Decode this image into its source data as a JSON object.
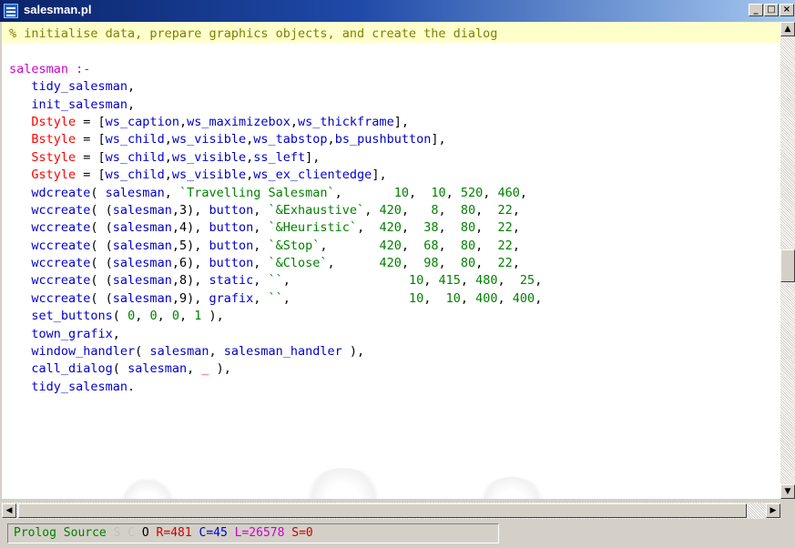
{
  "window": {
    "title": "salesman.pl",
    "controls": {
      "minimize": "_",
      "maximize": "□",
      "close": "×"
    }
  },
  "colors": {
    "comment": "#808000",
    "atom": "#0000cc",
    "head": "#cc00cc",
    "variable": "#ff0000",
    "string": "#008000",
    "number": "#008000",
    "punct": "#000000",
    "text": "#000080"
  },
  "code_lines": [
    [
      {
        "t": "% initialise data, prepare graphics objects, and create the dialog",
        "c": "comment"
      }
    ],
    [
      {
        "t": "",
        "c": "punct"
      }
    ],
    [
      {
        "t": "salesman :-",
        "c": "head"
      }
    ],
    [
      {
        "t": "   tidy_salesman",
        "c": "atom"
      },
      {
        "t": ",",
        "c": "punct"
      }
    ],
    [
      {
        "t": "   init_salesman",
        "c": "atom"
      },
      {
        "t": ",",
        "c": "punct"
      }
    ],
    [
      {
        "t": "   Dstyle",
        "c": "variable"
      },
      {
        "t": " = [",
        "c": "punct"
      },
      {
        "t": "ws_caption",
        "c": "atom"
      },
      {
        "t": ",",
        "c": "punct"
      },
      {
        "t": "ws_maximizebox",
        "c": "atom"
      },
      {
        "t": ",",
        "c": "punct"
      },
      {
        "t": "ws_thickframe",
        "c": "atom"
      },
      {
        "t": "],",
        "c": "punct"
      }
    ],
    [
      {
        "t": "   Bstyle",
        "c": "variable"
      },
      {
        "t": " = [",
        "c": "punct"
      },
      {
        "t": "ws_child",
        "c": "atom"
      },
      {
        "t": ",",
        "c": "punct"
      },
      {
        "t": "ws_visible",
        "c": "atom"
      },
      {
        "t": ",",
        "c": "punct"
      },
      {
        "t": "ws_tabstop",
        "c": "atom"
      },
      {
        "t": ",",
        "c": "punct"
      },
      {
        "t": "bs_pushbutton",
        "c": "atom"
      },
      {
        "t": "],",
        "c": "punct"
      }
    ],
    [
      {
        "t": "   Sstyle",
        "c": "variable"
      },
      {
        "t": " = [",
        "c": "punct"
      },
      {
        "t": "ws_child",
        "c": "atom"
      },
      {
        "t": ",",
        "c": "punct"
      },
      {
        "t": "ws_visible",
        "c": "atom"
      },
      {
        "t": ",",
        "c": "punct"
      },
      {
        "t": "ss_left",
        "c": "atom"
      },
      {
        "t": "],",
        "c": "punct"
      }
    ],
    [
      {
        "t": "   Gstyle",
        "c": "variable"
      },
      {
        "t": " = [",
        "c": "punct"
      },
      {
        "t": "ws_child",
        "c": "atom"
      },
      {
        "t": ",",
        "c": "punct"
      },
      {
        "t": "ws_visible",
        "c": "atom"
      },
      {
        "t": ",",
        "c": "punct"
      },
      {
        "t": "ws_ex_clientedge",
        "c": "atom"
      },
      {
        "t": "],",
        "c": "punct"
      }
    ],
    [
      {
        "t": "   wdcreate",
        "c": "atom"
      },
      {
        "t": "( ",
        "c": "punct"
      },
      {
        "t": "salesman",
        "c": "atom"
      },
      {
        "t": ", ",
        "c": "punct"
      },
      {
        "t": "`Travelling Salesman`",
        "c": "string"
      },
      {
        "t": ",       ",
        "c": "punct"
      },
      {
        "t": "10",
        "c": "number"
      },
      {
        "t": ",  ",
        "c": "punct"
      },
      {
        "t": "10",
        "c": "number"
      },
      {
        "t": ", ",
        "c": "punct"
      },
      {
        "t": "520",
        "c": "number"
      },
      {
        "t": ", ",
        "c": "punct"
      },
      {
        "t": "460",
        "c": "number"
      },
      {
        "t": ",",
        "c": "punct"
      }
    ],
    [
      {
        "t": "   wccreate",
        "c": "atom"
      },
      {
        "t": "( (",
        "c": "punct"
      },
      {
        "t": "salesman",
        "c": "atom"
      },
      {
        "t": ",3), ",
        "c": "punct"
      },
      {
        "t": "button",
        "c": "atom"
      },
      {
        "t": ", ",
        "c": "punct"
      },
      {
        "t": "`&Exhaustive`",
        "c": "string"
      },
      {
        "t": ", ",
        "c": "punct"
      },
      {
        "t": "420",
        "c": "number"
      },
      {
        "t": ",   ",
        "c": "punct"
      },
      {
        "t": "8",
        "c": "number"
      },
      {
        "t": ",  ",
        "c": "punct"
      },
      {
        "t": "80",
        "c": "number"
      },
      {
        "t": ",  ",
        "c": "punct"
      },
      {
        "t": "22",
        "c": "number"
      },
      {
        "t": ",",
        "c": "punct"
      }
    ],
    [
      {
        "t": "   wccreate",
        "c": "atom"
      },
      {
        "t": "( (",
        "c": "punct"
      },
      {
        "t": "salesman",
        "c": "atom"
      },
      {
        "t": ",4), ",
        "c": "punct"
      },
      {
        "t": "button",
        "c": "atom"
      },
      {
        "t": ", ",
        "c": "punct"
      },
      {
        "t": "`&Heuristic`",
        "c": "string"
      },
      {
        "t": ",  ",
        "c": "punct"
      },
      {
        "t": "420",
        "c": "number"
      },
      {
        "t": ",  ",
        "c": "punct"
      },
      {
        "t": "38",
        "c": "number"
      },
      {
        "t": ",  ",
        "c": "punct"
      },
      {
        "t": "80",
        "c": "number"
      },
      {
        "t": ",  ",
        "c": "punct"
      },
      {
        "t": "22",
        "c": "number"
      },
      {
        "t": ",",
        "c": "punct"
      }
    ],
    [
      {
        "t": "   wccreate",
        "c": "atom"
      },
      {
        "t": "( (",
        "c": "punct"
      },
      {
        "t": "salesman",
        "c": "atom"
      },
      {
        "t": ",5), ",
        "c": "punct"
      },
      {
        "t": "button",
        "c": "atom"
      },
      {
        "t": ", ",
        "c": "punct"
      },
      {
        "t": "`&Stop`",
        "c": "string"
      },
      {
        "t": ",       ",
        "c": "punct"
      },
      {
        "t": "420",
        "c": "number"
      },
      {
        "t": ",  ",
        "c": "punct"
      },
      {
        "t": "68",
        "c": "number"
      },
      {
        "t": ",  ",
        "c": "punct"
      },
      {
        "t": "80",
        "c": "number"
      },
      {
        "t": ",  ",
        "c": "punct"
      },
      {
        "t": "22",
        "c": "number"
      },
      {
        "t": ",",
        "c": "punct"
      }
    ],
    [
      {
        "t": "   wccreate",
        "c": "atom"
      },
      {
        "t": "( (",
        "c": "punct"
      },
      {
        "t": "salesman",
        "c": "atom"
      },
      {
        "t": ",6), ",
        "c": "punct"
      },
      {
        "t": "button",
        "c": "atom"
      },
      {
        "t": ", ",
        "c": "punct"
      },
      {
        "t": "`&Close`",
        "c": "string"
      },
      {
        "t": ",      ",
        "c": "punct"
      },
      {
        "t": "420",
        "c": "number"
      },
      {
        "t": ",  ",
        "c": "punct"
      },
      {
        "t": "98",
        "c": "number"
      },
      {
        "t": ",  ",
        "c": "punct"
      },
      {
        "t": "80",
        "c": "number"
      },
      {
        "t": ",  ",
        "c": "punct"
      },
      {
        "t": "22",
        "c": "number"
      },
      {
        "t": ",",
        "c": "punct"
      }
    ],
    [
      {
        "t": "   wccreate",
        "c": "atom"
      },
      {
        "t": "( (",
        "c": "punct"
      },
      {
        "t": "salesman",
        "c": "atom"
      },
      {
        "t": ",8), ",
        "c": "punct"
      },
      {
        "t": "static",
        "c": "atom"
      },
      {
        "t": ", ",
        "c": "punct"
      },
      {
        "t": "``",
        "c": "string"
      },
      {
        "t": ",                ",
        "c": "punct"
      },
      {
        "t": "10",
        "c": "number"
      },
      {
        "t": ", ",
        "c": "punct"
      },
      {
        "t": "415",
        "c": "number"
      },
      {
        "t": ", ",
        "c": "punct"
      },
      {
        "t": "480",
        "c": "number"
      },
      {
        "t": ",  ",
        "c": "punct"
      },
      {
        "t": "25",
        "c": "number"
      },
      {
        "t": ",",
        "c": "punct"
      }
    ],
    [
      {
        "t": "   wccreate",
        "c": "atom"
      },
      {
        "t": "( (",
        "c": "punct"
      },
      {
        "t": "salesman",
        "c": "atom"
      },
      {
        "t": ",9), ",
        "c": "punct"
      },
      {
        "t": "grafix",
        "c": "atom"
      },
      {
        "t": ", ",
        "c": "punct"
      },
      {
        "t": "``",
        "c": "string"
      },
      {
        "t": ",                ",
        "c": "punct"
      },
      {
        "t": "10",
        "c": "number"
      },
      {
        "t": ",  ",
        "c": "punct"
      },
      {
        "t": "10",
        "c": "number"
      },
      {
        "t": ", ",
        "c": "punct"
      },
      {
        "t": "400",
        "c": "number"
      },
      {
        "t": ", ",
        "c": "punct"
      },
      {
        "t": "400",
        "c": "number"
      },
      {
        "t": ",",
        "c": "punct"
      }
    ],
    [
      {
        "t": "   set_buttons",
        "c": "atom"
      },
      {
        "t": "( ",
        "c": "punct"
      },
      {
        "t": "0",
        "c": "number"
      },
      {
        "t": ", ",
        "c": "punct"
      },
      {
        "t": "0",
        "c": "number"
      },
      {
        "t": ", ",
        "c": "punct"
      },
      {
        "t": "0",
        "c": "number"
      },
      {
        "t": ", ",
        "c": "punct"
      },
      {
        "t": "1",
        "c": "number"
      },
      {
        "t": " ),",
        "c": "punct"
      }
    ],
    [
      {
        "t": "   town_grafix",
        "c": "atom"
      },
      {
        "t": ",",
        "c": "punct"
      }
    ],
    [
      {
        "t": "   window_handler",
        "c": "atom"
      },
      {
        "t": "( ",
        "c": "punct"
      },
      {
        "t": "salesman",
        "c": "atom"
      },
      {
        "t": ", ",
        "c": "punct"
      },
      {
        "t": "salesman_handler",
        "c": "atom"
      },
      {
        "t": " ),",
        "c": "punct"
      }
    ],
    [
      {
        "t": "   call_dialog",
        "c": "atom"
      },
      {
        "t": "( ",
        "c": "punct"
      },
      {
        "t": "salesman",
        "c": "atom"
      },
      {
        "t": ", ",
        "c": "punct"
      },
      {
        "t": "_",
        "c": "variable"
      },
      {
        "t": " ),",
        "c": "punct"
      }
    ],
    [
      {
        "t": "   tidy_salesman",
        "c": "atom"
      },
      {
        "t": ".",
        "c": "punct"
      }
    ]
  ],
  "scrollbar": {
    "up": "▲",
    "down": "▼",
    "left": "◀",
    "right": "▶"
  },
  "status": {
    "mode": "Prolog Source",
    "flag_s": "S",
    "flag_c": "C",
    "flag_o": "O",
    "row": "R=481",
    "col": "C=45",
    "length": "L=26578",
    "sel": "S=0"
  },
  "status_colors": {
    "mode": "#008000",
    "faded": "#c0c0c0",
    "o": "#000000",
    "row": "#cc0000",
    "col": "#0000cc",
    "length": "#cc00cc",
    "sel": "#cc0000"
  }
}
